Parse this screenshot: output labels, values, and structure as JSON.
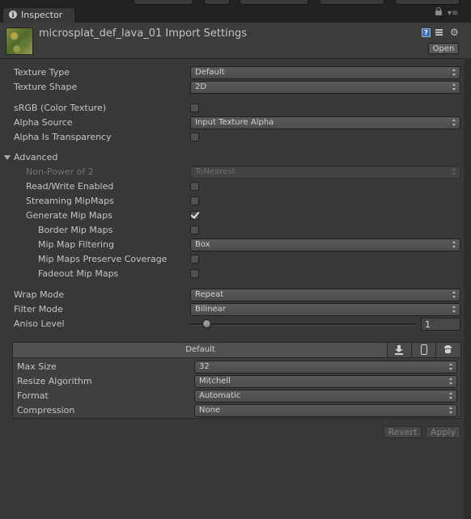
{
  "window": {
    "tab_label": "Inspector",
    "tab_icon": "info-icon",
    "lock_icon": "lock-icon",
    "menu_icon": "panel-menu-icon"
  },
  "header": {
    "title": "microsplat_def_lava_01 Import Settings",
    "open_label": "Open",
    "icons": [
      "help-icon",
      "preset-icon",
      "gear-icon"
    ]
  },
  "fields": {
    "texture_type": {
      "label": "Texture Type",
      "value": "Default"
    },
    "texture_shape": {
      "label": "Texture Shape",
      "value": "2D"
    },
    "srgb": {
      "label": "sRGB (Color Texture)",
      "checked": false
    },
    "alpha_source": {
      "label": "Alpha Source",
      "value": "Input Texture Alpha"
    },
    "alpha_is_transparency": {
      "label": "Alpha Is Transparency",
      "checked": false
    },
    "advanced": {
      "label": "Advanced",
      "expanded": true
    },
    "non_power_of_2": {
      "label": "Non-Power of 2",
      "value": "ToNearest",
      "disabled": true
    },
    "read_write": {
      "label": "Read/Write Enabled",
      "checked": false
    },
    "streaming_mipmaps": {
      "label": "Streaming MipMaps",
      "checked": false
    },
    "generate_mip_maps": {
      "label": "Generate Mip Maps",
      "checked": true
    },
    "border_mip_maps": {
      "label": "Border Mip Maps",
      "checked": false
    },
    "mip_map_filtering": {
      "label": "Mip Map Filtering",
      "value": "Box"
    },
    "mip_maps_preserve_coverage": {
      "label": "Mip Maps Preserve Coverage",
      "checked": false
    },
    "fadeout_mip_maps": {
      "label": "Fadeout Mip Maps",
      "checked": false
    },
    "wrap_mode": {
      "label": "Wrap Mode",
      "value": "Repeat"
    },
    "filter_mode": {
      "label": "Filter Mode",
      "value": "Bilinear"
    },
    "aniso_level": {
      "label": "Aniso Level",
      "value": "1"
    }
  },
  "platform": {
    "default_tab": "Default",
    "tab_icons": [
      "download-icon",
      "phone-icon",
      "android-icon"
    ],
    "max_size": {
      "label": "Max Size",
      "value": "32"
    },
    "resize_algorithm": {
      "label": "Resize Algorithm",
      "value": "Mitchell"
    },
    "format": {
      "label": "Format",
      "value": "Automatic"
    },
    "compression": {
      "label": "Compression",
      "value": "None"
    }
  },
  "actions": {
    "revert_label": "Revert",
    "apply_label": "Apply"
  }
}
